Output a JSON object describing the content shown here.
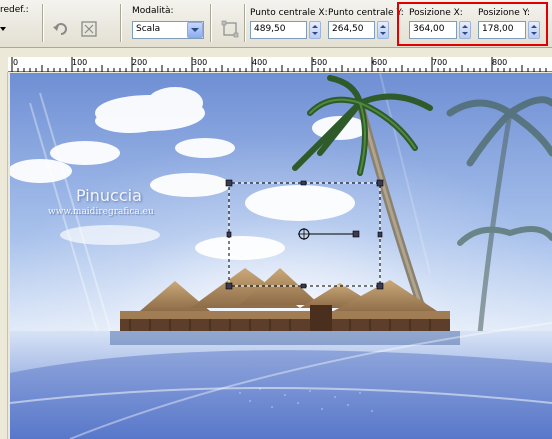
{
  "toolbar": {
    "preset_label": "redef.:",
    "mode_label": "Modalità:",
    "mode_value": "Scala",
    "center_x_label": "Punto centrale X:",
    "center_x_value": "489,50",
    "center_y_label": "Punto centrale Y:",
    "center_y_value": "264,50",
    "pos_x_label": "Posizione X:",
    "pos_x_value": "364,00",
    "pos_y_label": "Posizione Y:",
    "pos_y_value": "178,00"
  },
  "ruler": {
    "labels": [
      "0",
      "100",
      "200",
      "300",
      "400",
      "500",
      "600",
      "700",
      "800"
    ]
  },
  "canvas": {
    "watermark_name": "Pinuccia",
    "watermark_url": "www.maidiregrafica.eu"
  },
  "colors": {
    "highlight": "#e00000",
    "sky_top": "#6f8fd4",
    "sky_light": "#dfe9f8",
    "field_border": "#7f9db9"
  },
  "icons": [
    "dropdown-arrow-icon",
    "undo-icon",
    "reset-icon",
    "combo-arrow-icon",
    "spin-icon",
    "deform-tool-icon"
  ]
}
